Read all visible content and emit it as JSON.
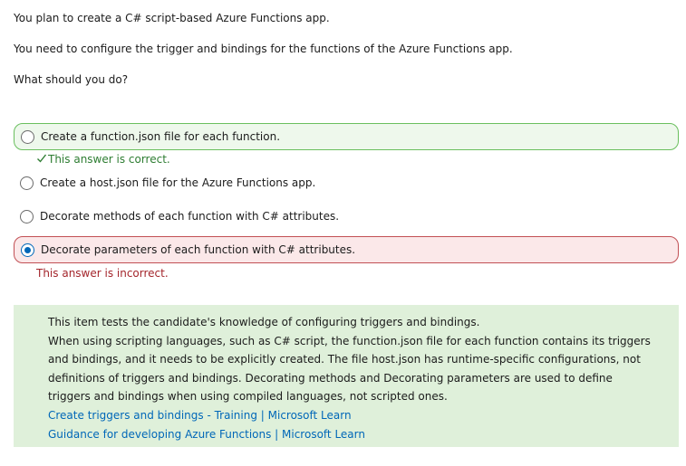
{
  "question": {
    "lines": [
      "You plan to create a C# script-based Azure Functions app.",
      "You need to configure the trigger and bindings for the functions of the Azure Functions app.",
      "What should you do?"
    ]
  },
  "options": [
    {
      "label": "Create a function.json file for each function.",
      "selected": false,
      "status": "correct"
    },
    {
      "label": "Create a host.json file for the Azure Functions app.",
      "selected": false,
      "status": "none"
    },
    {
      "label": "Decorate methods of each function with C# attributes.",
      "selected": false,
      "status": "none"
    },
    {
      "label": "Decorate parameters of each function with C# attributes.",
      "selected": true,
      "status": "incorrect"
    }
  ],
  "feedback": {
    "correct": "This answer is correct.",
    "incorrect": "This answer is incorrect."
  },
  "explanation": {
    "lines": [
      "This item tests the candidate's knowledge of configuring triggers and bindings.",
      "When using scripting languages, such as C# script, the function.json file for each function contains its triggers",
      "and bindings, and it needs to be explicitly created. The file host.json has runtime-specific configurations, not",
      "definitions of triggers and bindings. Decorating methods and Decorating parameters are used to define",
      "triggers and bindings when using compiled languages, not scripted ones."
    ],
    "links": [
      "Create triggers and bindings - Training | Microsoft Learn",
      "Guidance for developing Azure Functions | Microsoft Learn"
    ]
  },
  "colors": {
    "correct_border": "#6abf5e",
    "correct_text": "#2e7d32",
    "incorrect_border": "#c25055",
    "incorrect_text": "#a4262c",
    "explanation_bg": "#dff0da",
    "link": "#0067b8",
    "radio_selected": "#0067b8"
  },
  "icons": {
    "correct_marker": "checkmark-icon"
  }
}
